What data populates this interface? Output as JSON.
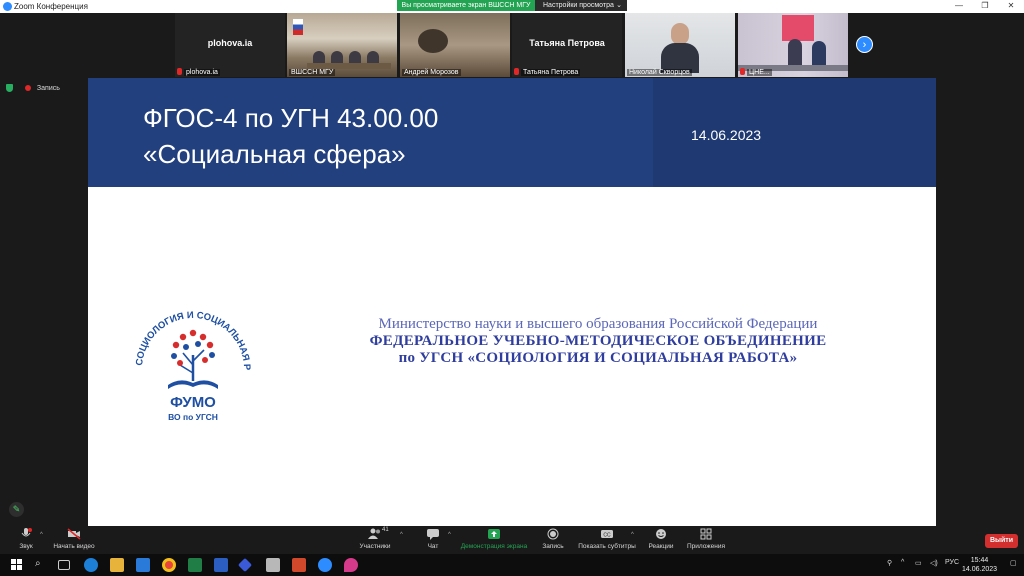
{
  "window": {
    "title": "Zoom Конференция"
  },
  "banner": {
    "sharing_text": "Вы просматриваете экран ВШССН МГУ",
    "view_options": "Настройки просмотра"
  },
  "participants": [
    {
      "big_name": "plohova.ia",
      "tag": "plohova.ia",
      "muted": true
    },
    {
      "big_name": "",
      "tag": "ВШССН МГУ",
      "muted": false
    },
    {
      "big_name": "",
      "tag": "Андрей Морозов",
      "muted": false
    },
    {
      "big_name": "Татьяна Петрова",
      "tag": "Татьяна Петрова",
      "muted": true
    },
    {
      "big_name": "",
      "tag": "Николай Скворцов",
      "muted": false
    },
    {
      "big_name": "",
      "tag": "ЦНЕ...",
      "muted": true
    }
  ],
  "recording": {
    "label": "Запись"
  },
  "slide": {
    "title_line1": "ФГОС-4 по УГН 43.00.00",
    "title_line2": "«Социальная сфера»",
    "date": "14.06.2023",
    "logo_arc_text": "СОЦИОЛОГИЯ И СОЦИАЛЬНАЯ РАБОТА",
    "logo_main": "ФУМО",
    "logo_sub": "ВО по УГСН",
    "ministry_line1": "Министерство науки и высшего образования Российской Федерации",
    "ministry_line2": "ФЕДЕРАЛЬНОЕ УЧЕБНО-МЕТОДИЧЕСКОЕ ОБЪЕДИНЕНИЕ",
    "ministry_line3": "по УГСН «СОЦИОЛОГИЯ И СОЦИАЛЬНАЯ РАБОТА»"
  },
  "toolbar": {
    "audio": "Звук",
    "video": "Начать видео",
    "participants": "Участники",
    "participants_count": "41",
    "chat": "Чат",
    "share": "Демонстрация экрана",
    "record": "Запись",
    "captions": "Показать субтитры",
    "reactions": "Реакции",
    "apps": "Приложения",
    "leave": "Выйти"
  },
  "taskbar": {
    "lang": "РУС",
    "time": "15:44",
    "date": "14.06.2023"
  },
  "colors": {
    "accent": "#2d8cff",
    "share_green": "#23a453",
    "slide_blue": "#23407e",
    "leave_red": "#d32f2f"
  }
}
